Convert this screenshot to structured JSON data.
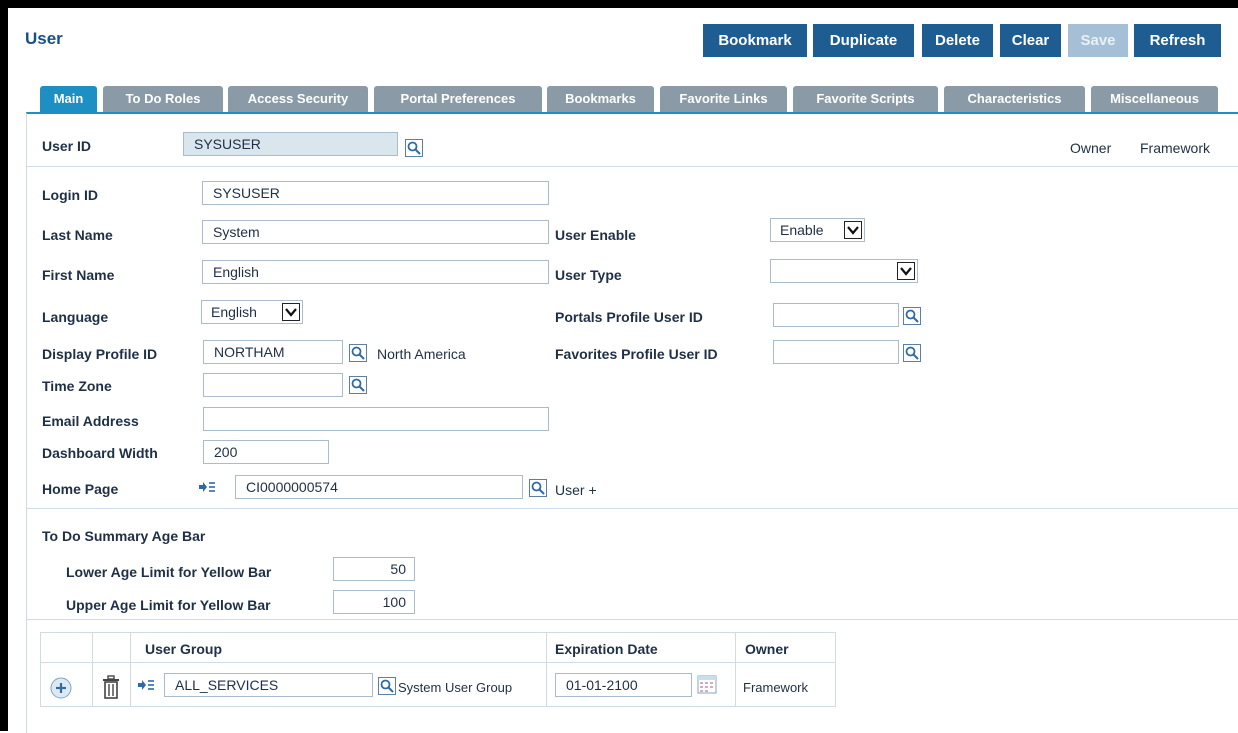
{
  "page": {
    "title": "User"
  },
  "toolbar": {
    "bookmark": "Bookmark",
    "duplicate": "Duplicate",
    "delete": "Delete",
    "clear": "Clear",
    "save": "Save",
    "refresh": "Refresh"
  },
  "tabs": [
    "Main",
    "To Do Roles",
    "Access Security",
    "Portal Preferences",
    "Bookmarks",
    "Favorite Links",
    "Favorite Scripts",
    "Characteristics",
    "Miscellaneous"
  ],
  "form": {
    "user_id_label": "User ID",
    "user_id_value": "SYSUSER",
    "owner_label": "Owner",
    "owner_value": "Framework",
    "login_id_label": "Login ID",
    "login_id_value": "SYSUSER",
    "last_name_label": "Last Name",
    "last_name_value": "System",
    "first_name_label": "First Name",
    "first_name_value": "English",
    "language_label": "Language",
    "language_value": "English",
    "display_profile_label": "Display Profile ID",
    "display_profile_value": "NORTHAM",
    "display_profile_desc": "North America",
    "time_zone_label": "Time Zone",
    "time_zone_value": "",
    "email_label": "Email Address",
    "email_value": "",
    "dashboard_width_label": "Dashboard Width",
    "dashboard_width_value": "200",
    "home_page_label": "Home Page",
    "home_page_value": "CI0000000574",
    "home_page_desc": "User +",
    "user_enable_label": "User Enable",
    "user_enable_value": "Enable",
    "user_type_label": "User Type",
    "user_type_value": "",
    "portals_profile_label": "Portals Profile User ID",
    "portals_profile_value": "",
    "favorites_profile_label": "Favorites Profile User ID",
    "favorites_profile_value": ""
  },
  "age_bar": {
    "heading": "To Do Summary Age Bar",
    "lower_label": "Lower Age Limit for Yellow Bar",
    "lower_value": "50",
    "upper_label": "Upper Age Limit for Yellow Bar",
    "upper_value": "100"
  },
  "grid": {
    "headers": {
      "user_group": "User Group",
      "expiration_date": "Expiration Date",
      "owner": "Owner"
    },
    "rows": [
      {
        "user_group": "ALL_SERVICES",
        "description": "System User Group",
        "expiration_date": "01-01-2100",
        "owner": "Framework"
      }
    ]
  },
  "colors": {
    "accent": "#1d5d92",
    "tab_active": "#1d8fc2",
    "tab_inactive": "#8a9aa6"
  }
}
